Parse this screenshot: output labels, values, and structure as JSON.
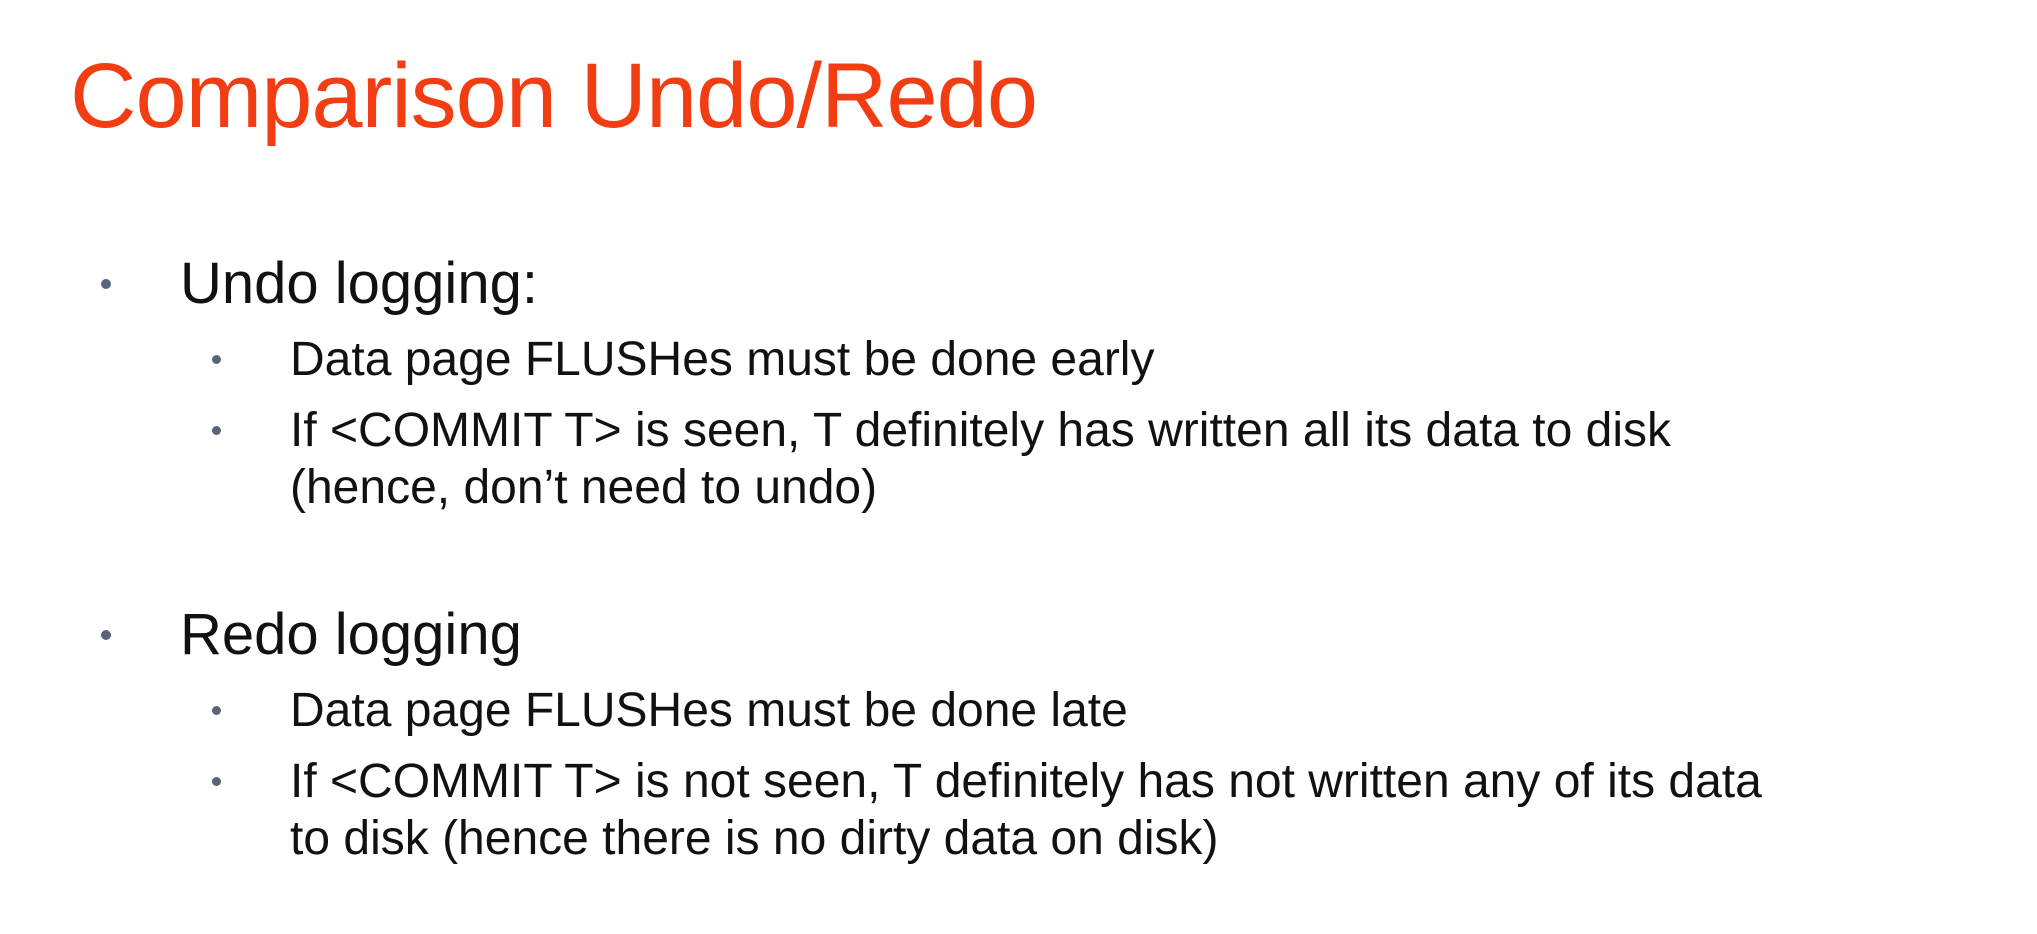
{
  "slide": {
    "title": "Comparison Undo/Redo",
    "title_color": "#f23d13",
    "bullet_color": "#59647a",
    "sections": [
      {
        "heading": "Undo logging:",
        "items": [
          "Data page FLUSHes must be done early",
          "If <COMMIT T> is seen, T definitely has written all its data to disk",
          "(hence, don’t need to undo)"
        ]
      },
      {
        "heading": "Redo logging",
        "items": [
          "Data page FLUSHes must be done late",
          "If <COMMIT T> is not seen, T definitely has not written any of its data",
          "to disk (hence there is no dirty data on disk)"
        ]
      }
    ]
  }
}
